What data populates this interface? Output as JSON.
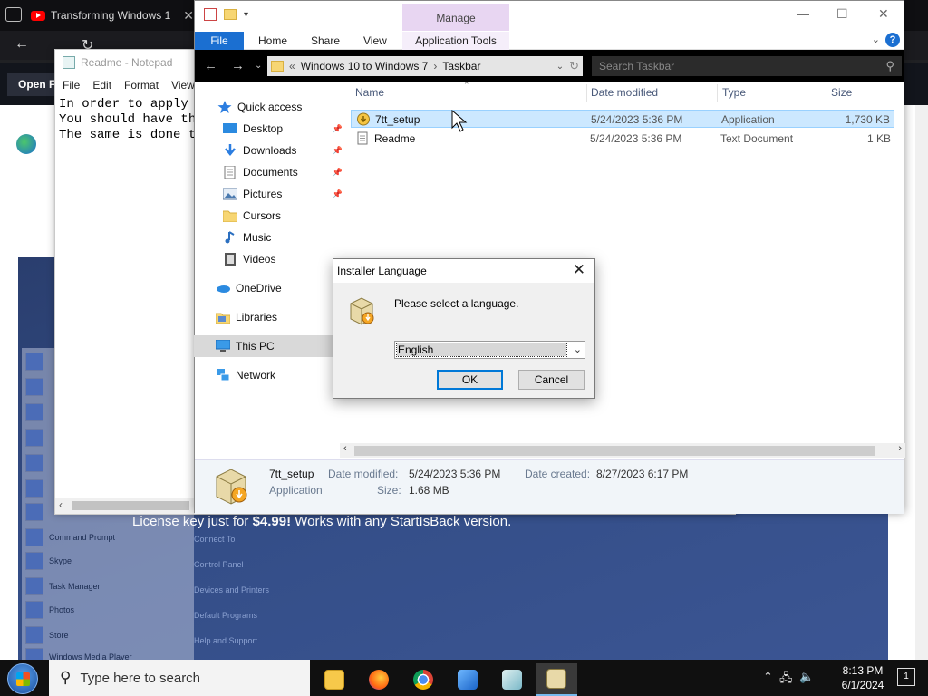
{
  "browser": {
    "tab_title": "Transforming Windows 1",
    "open_button": "Open F",
    "hero_text_pre": "License key just for ",
    "hero_price": "$4.99!",
    "hero_text_post": " Works with any StartIsBack version.",
    "start_menu_items": [
      "Command Prompt",
      "Skype",
      "Task Manager",
      "Photos",
      "Store",
      "Windows Media Player"
    ],
    "start_menu_right": [
      "Connect To",
      "Control Panel",
      "Devices and Printers",
      "Default Programs",
      "Help and Support"
    ]
  },
  "notepad": {
    "title": "Readme - Notepad",
    "menu": [
      "File",
      "Edit",
      "Format",
      "View"
    ],
    "lines": [
      "In order to apply t",
      "You should have the",
      "The same is done to"
    ]
  },
  "explorer": {
    "manage_label": "Manage",
    "ribbon_tabs": [
      "File",
      "Home",
      "Share",
      "View"
    ],
    "app_tools_label": "Application Tools",
    "help_label": "?",
    "path": [
      "Windows 10 to Windows 7",
      "Taskbar"
    ],
    "search_placeholder": "Search Taskbar",
    "nav": [
      {
        "label": "Quick access",
        "icon": "star-icon"
      },
      {
        "label": "Desktop",
        "icon": "desktop-icon",
        "pinned": true
      },
      {
        "label": "Downloads",
        "icon": "download-icon",
        "pinned": true
      },
      {
        "label": "Documents",
        "icon": "document-icon",
        "pinned": true
      },
      {
        "label": "Pictures",
        "icon": "pictures-icon",
        "pinned": true
      },
      {
        "label": "Cursors",
        "icon": "folder-icon"
      },
      {
        "label": "Music",
        "icon": "music-icon"
      },
      {
        "label": "Videos",
        "icon": "video-icon"
      },
      {
        "label": "OneDrive",
        "icon": "cloud-icon"
      },
      {
        "label": "Libraries",
        "icon": "library-icon"
      },
      {
        "label": "This PC",
        "icon": "computer-icon"
      },
      {
        "label": "Network",
        "icon": "network-icon"
      }
    ],
    "columns": [
      "Name",
      "Date modified",
      "Type",
      "Size"
    ],
    "files": [
      {
        "name": "7tt_setup",
        "date": "5/24/2023 5:36 PM",
        "type": "Application",
        "size": "1,730 KB"
      },
      {
        "name": "Readme",
        "date": "5/24/2023 5:36 PM",
        "type": "Text Document",
        "size": "1 KB"
      }
    ],
    "details": {
      "name": "7tt_setup",
      "kind": "Application",
      "modified_label": "Date modified:",
      "modified_value": "5/24/2023 5:36 PM",
      "created_label": "Date created:",
      "created_value": "8/27/2023 6:17 PM",
      "size_label": "Size:",
      "size_value": "1.68 MB"
    }
  },
  "dialog": {
    "title": "Installer Language",
    "prompt": "Please select a language.",
    "selected_language": "English",
    "ok_label": "OK",
    "cancel_label": "Cancel"
  },
  "taskbar": {
    "search_placeholder": "Type here to search",
    "time": "8:13 PM",
    "date": "6/1/2024",
    "notification_count": "1",
    "apps": [
      "file-explorer-icon",
      "firefox-icon",
      "chrome-icon",
      "photos-icon",
      "notepad-icon",
      "installer-icon"
    ]
  },
  "colors": {
    "accent": "#1b6fd1",
    "selection": "#cce8ff",
    "manage_tab": "#e8d6f2"
  }
}
